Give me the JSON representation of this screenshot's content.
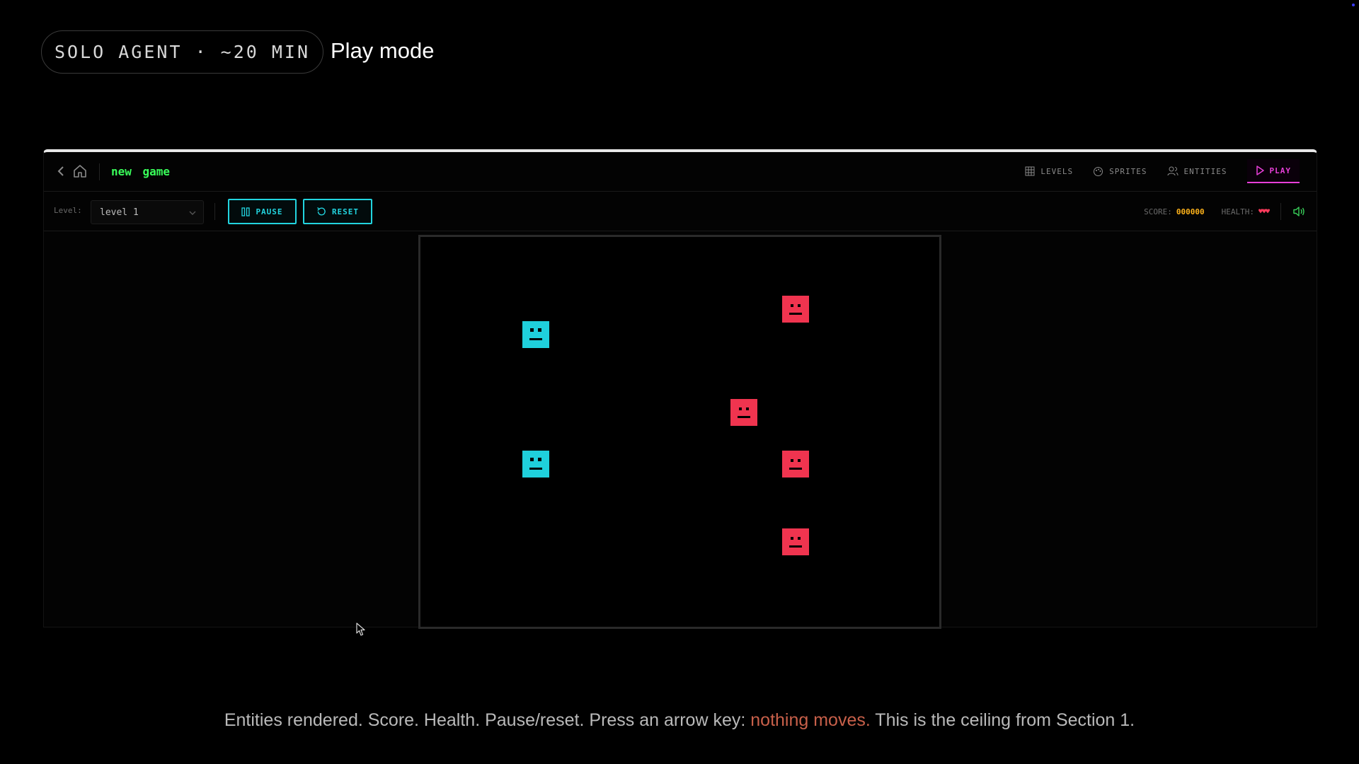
{
  "header": {
    "pill_label": "SOLO AGENT · ~20 MIN",
    "title": "Play mode"
  },
  "app": {
    "project_name": "new game",
    "nav": {
      "levels": "LEVELS",
      "sprites": "SPRITES",
      "entities": "ENTITIES",
      "play": "PLAY"
    },
    "toolbar": {
      "level_label": "Level:",
      "level_selected": "level 1",
      "pause_label": "PAUSE",
      "reset_label": "RESET"
    },
    "status": {
      "score_label": "SCORE:",
      "score_value": "000000",
      "health_label": "HEALTH:",
      "health_value": "♥♥♥"
    },
    "game": {
      "entities": [
        {
          "kind": "player",
          "color": "#1fd0dc"
        },
        {
          "kind": "player",
          "color": "#1fd0dc"
        },
        {
          "kind": "enemy",
          "color": "#f0344f"
        },
        {
          "kind": "enemy",
          "color": "#f0344f"
        },
        {
          "kind": "enemy",
          "color": "#f0344f"
        },
        {
          "kind": "enemy",
          "color": "#f0344f"
        }
      ]
    }
  },
  "caption": {
    "before": "Entities rendered. Score. Health. Pause/reset. Press an arrow key: ",
    "highlight": "nothing moves.",
    "after": " This is the ceiling from Section 1."
  },
  "colors": {
    "accent_green": "#39ff5a",
    "accent_cyan": "#22d4df",
    "accent_magenta": "#e83fd9",
    "score": "#ffb31a",
    "health": "#ff3b5c",
    "caption_highlight": "#c8604a"
  }
}
